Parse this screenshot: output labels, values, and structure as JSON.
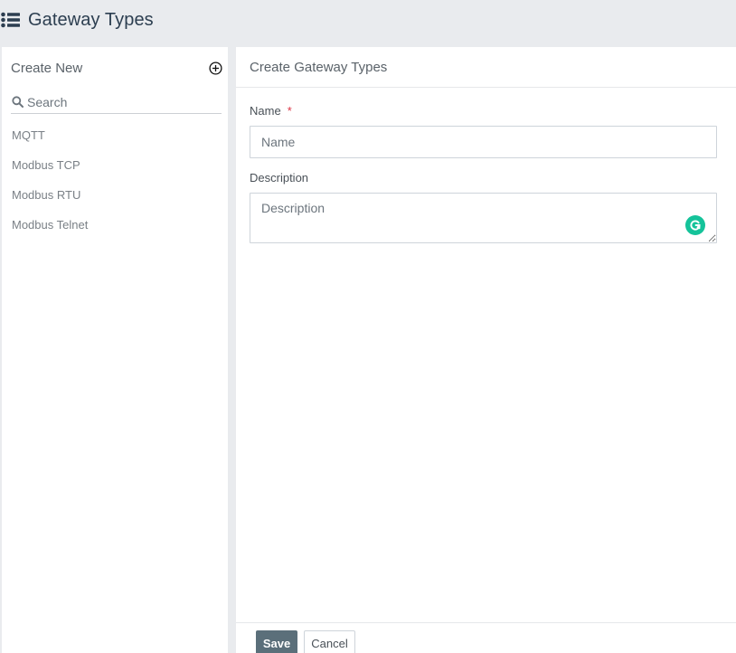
{
  "header": {
    "icon": "list-icon",
    "title": "Gateway Types"
  },
  "sidebar": {
    "create_label": "Create New",
    "add_icon": "plus-circle-icon",
    "search": {
      "icon": "search-icon",
      "placeholder": "Search",
      "value": ""
    },
    "items": [
      {
        "label": "MQTT"
      },
      {
        "label": "Modbus TCP"
      },
      {
        "label": "Modbus RTU"
      },
      {
        "label": "Modbus Telnet"
      }
    ]
  },
  "main": {
    "title": "Create Gateway Types",
    "form": {
      "name": {
        "label": "Name",
        "required_mark": "*",
        "placeholder": "Name",
        "value": ""
      },
      "description": {
        "label": "Description",
        "placeholder": "Description",
        "value": ""
      },
      "assistant_icon": "grammarly-icon"
    },
    "footer": {
      "save_label": "Save",
      "cancel_label": "Cancel"
    }
  },
  "colors": {
    "page_background": "#e9ebee",
    "title_text": "#2c3e50",
    "required": "#dc3545",
    "save_button": "#5b6f7a",
    "grammarly": "#15c39a"
  }
}
